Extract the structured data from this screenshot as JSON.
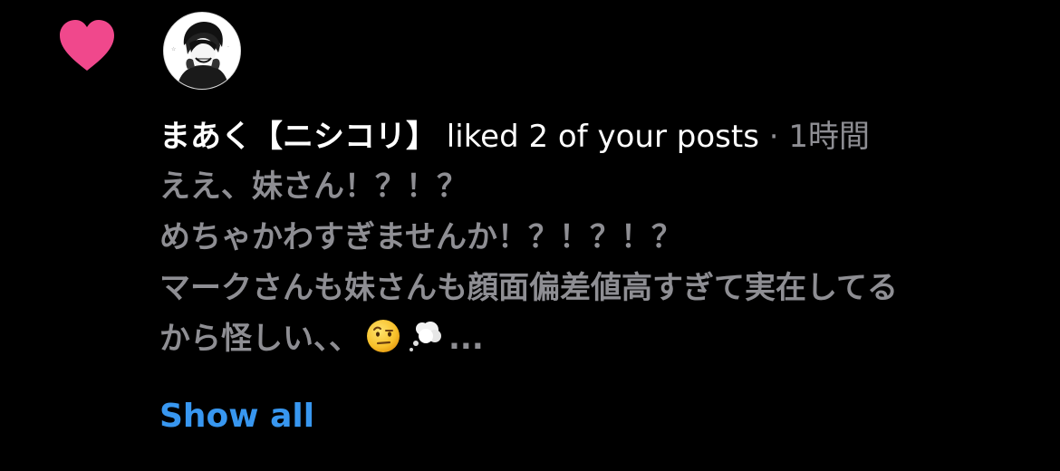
{
  "notification": {
    "username": "まあく【ニシコリ】",
    "action": " liked 2 of your posts",
    "separator": " · ",
    "time": "1時間",
    "comment_lines": [
      "ええ、妹さん！？！？",
      "めちゃかわすぎませんか！？！？！？",
      "マークさんも妹さんも顔面偏差値高すぎて実在してる",
      "から怪しい、、"
    ],
    "ellipsis": "...",
    "show_all_label": "Show all"
  },
  "icons": {
    "heart": "heart-icon",
    "avatar": "avatar",
    "raised_eyebrow": "face-with-raised-eyebrow-icon",
    "thought_balloon": "thought-balloon-icon"
  },
  "colors": {
    "background": "#000000",
    "heart": "#f0488c",
    "link": "#3897f0",
    "muted_text": "#8e8e93",
    "primary_text": "#ffffff"
  }
}
